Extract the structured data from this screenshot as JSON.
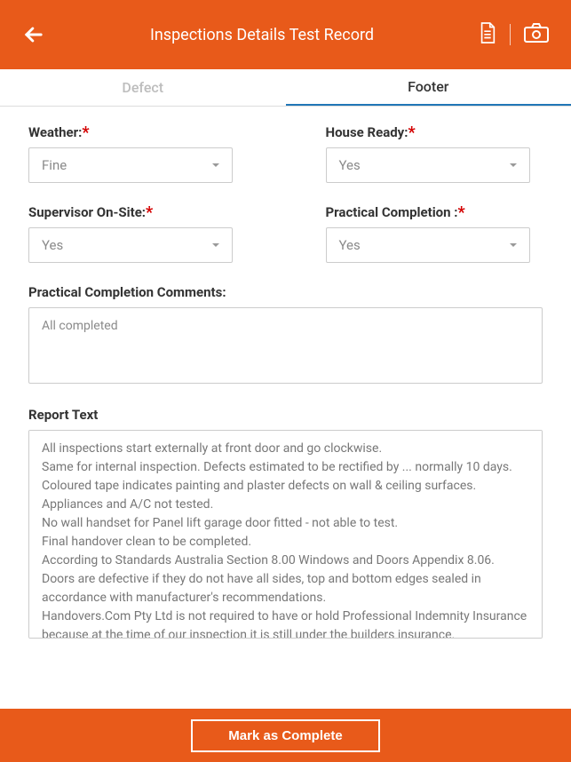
{
  "header": {
    "title": "Inspections Details Test Record"
  },
  "tabs": {
    "defect": "Defect",
    "footer": "Footer"
  },
  "fields": {
    "weather": {
      "label": "Weather:",
      "value": "Fine"
    },
    "house": {
      "label": "House Ready:",
      "value": "Yes"
    },
    "supervisor": {
      "label": "Supervisor On-Site:",
      "value": "Yes"
    },
    "practical": {
      "label": "Practical Completion :",
      "value": "Yes"
    }
  },
  "comments": {
    "label": "Practical Completion Comments:",
    "value": "All completed"
  },
  "report": {
    "label": "Report Text",
    "value": "All inspections start externally at front door and go clockwise.\nSame for internal inspection. Defects estimated to be rectified by ... normally 10 days.\nColoured tape indicates painting and plaster defects on wall & ceiling surfaces.\nAppliances and A/C not tested.\nNo wall handset for Panel lift garage door fitted - not able to test.\nFinal handover clean to be completed.\nAccording to Standards Australia Section 8.00 Windows and Doors Appendix 8.06. Doors are defective if they do not have all sides, top and bottom edges sealed in accordance with manufacturer's recommendations.\nHandovers.Com Pty Ltd is not required to have or hold Professional Indemnity Insurance because at the time of our inspection it is still under the builders insurance."
  },
  "actions": {
    "complete": "Mark as Complete"
  }
}
